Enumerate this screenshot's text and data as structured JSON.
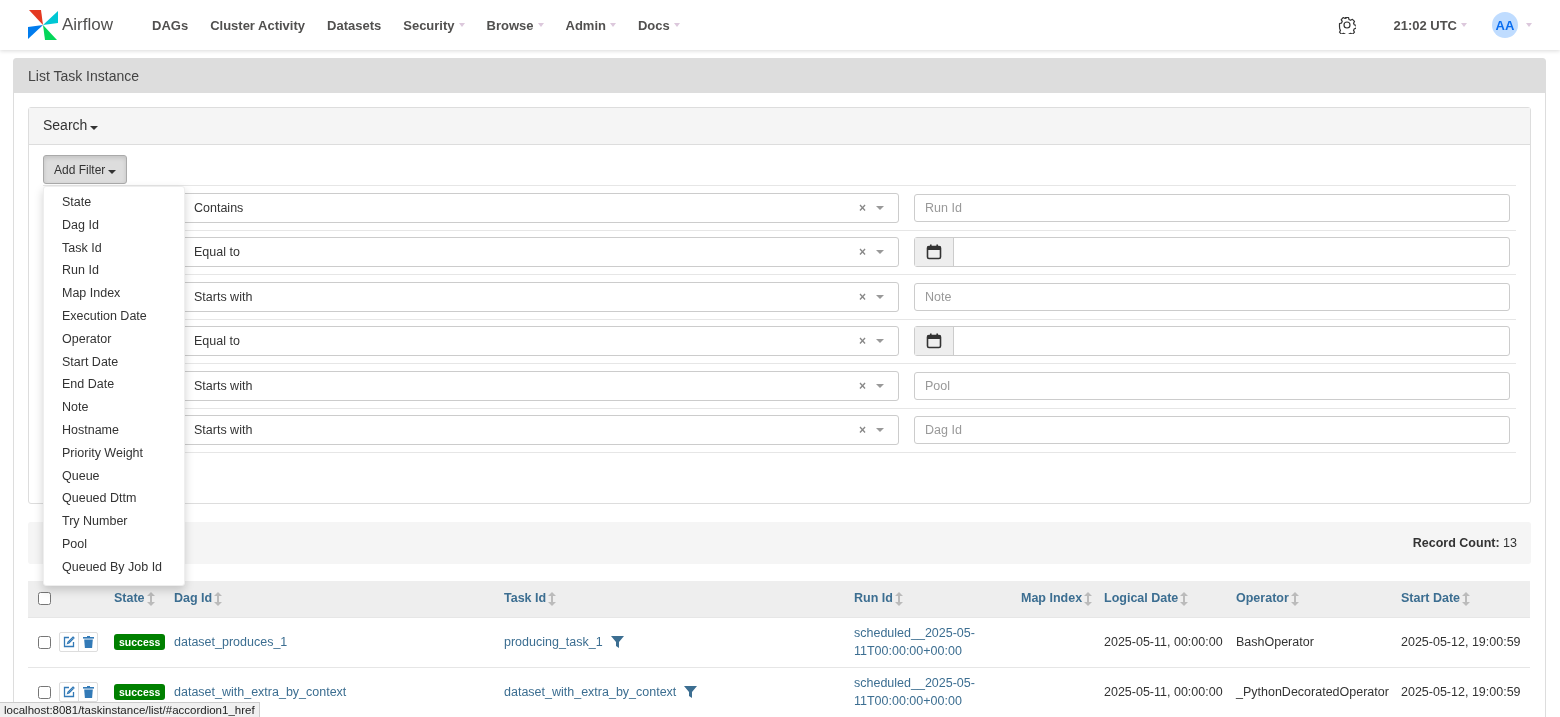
{
  "navbar": {
    "brand": "Airflow",
    "items": [
      {
        "label": "DAGs",
        "dropdown": false
      },
      {
        "label": "Cluster Activity",
        "dropdown": false
      },
      {
        "label": "Datasets",
        "dropdown": false
      },
      {
        "label": "Security",
        "dropdown": true
      },
      {
        "label": "Browse",
        "dropdown": true
      },
      {
        "label": "Admin",
        "dropdown": true
      },
      {
        "label": "Docs",
        "dropdown": true
      }
    ],
    "time": "21:02 UTC",
    "avatar": "AA"
  },
  "panel_title": "List Task Instance",
  "search": {
    "title": "Search",
    "add_filter": "Add Filter",
    "filter_menu": [
      "State",
      "Dag Id",
      "Task Id",
      "Run Id",
      "Map Index",
      "Execution Date",
      "Operator",
      "Start Date",
      "End Date",
      "Note",
      "Hostname",
      "Priority Weight",
      "Queue",
      "Queued Dttm",
      "Try Number",
      "Pool",
      "Queued By Job Id"
    ],
    "filters": [
      {
        "operator": "Contains",
        "clear": "×",
        "kind": "text",
        "placeholder": "Run Id"
      },
      {
        "operator": "Equal to",
        "clear": "×",
        "kind": "date"
      },
      {
        "operator": "Starts with",
        "clear": "×",
        "kind": "text",
        "placeholder": "Note"
      },
      {
        "operator": "Equal to",
        "clear": "×",
        "kind": "date"
      },
      {
        "operator": "Starts with",
        "clear": "×",
        "kind": "text",
        "placeholder": "Pool"
      },
      {
        "operator": "Starts with",
        "clear": "×",
        "kind": "text",
        "placeholder": "Dag Id"
      }
    ]
  },
  "record_count": {
    "label": "Record Count:",
    "value": "13"
  },
  "table": {
    "all_checked": false,
    "columns": [
      "State",
      "Dag Id",
      "Task Id",
      "Run Id",
      "Map Index",
      "Logical Date",
      "Operator",
      "Start Date"
    ],
    "rows": [
      {
        "checked": false,
        "state": "success",
        "dag_id": "dataset_produces_1",
        "task_id": "producing_task_1",
        "run_id": "scheduled__2025-05-11T00:00:00+00:00",
        "logical_date": "2025-05-11, 00:00:00",
        "operator": "BashOperator",
        "start_date": "2025-05-12, 19:00:59"
      },
      {
        "checked": false,
        "state": "success",
        "dag_id": "dataset_with_extra_by_context",
        "task_id": "dataset_with_extra_by_context",
        "run_id": "scheduled__2025-05-11T00:00:00+00:00",
        "logical_date": "2025-05-11, 00:00:00",
        "operator": "_PythonDecoratedOperator",
        "start_date": "2025-05-12, 19:00:59"
      }
    ]
  },
  "status_url": "localhost:8081/taskinstance/list/#accordion1_href"
}
